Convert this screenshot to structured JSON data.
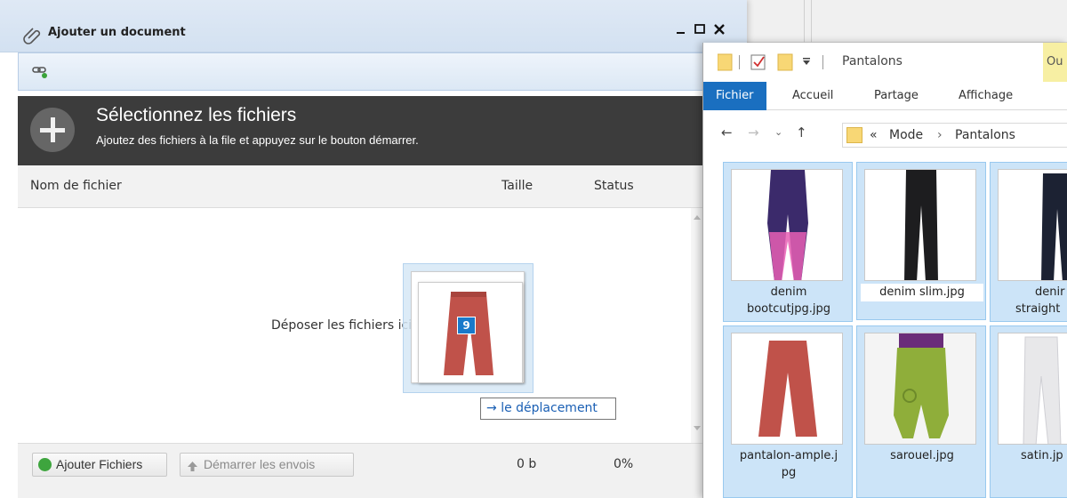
{
  "dialog": {
    "title": "Ajouter un document",
    "header_title": "Sélectionnez les fichiers",
    "header_subtitle": "Ajoutez des fichiers à la file et appuyez sur le bouton démarrer.",
    "columns": {
      "name": "Nom de fichier",
      "size": "Taille",
      "status": "Status"
    },
    "drop_text": "Déposer les fichiers ici.",
    "drag_count": "9",
    "drag_tooltip": "le déplacement",
    "buttons": {
      "add": "Ajouter Fichiers",
      "start": "Démarrer les envois"
    },
    "footer": {
      "size": "0 b",
      "percent": "0%"
    },
    "window_controls": [
      "minimize-icon",
      "maximize-icon",
      "close-icon"
    ]
  },
  "explorer": {
    "title": "Pantalons",
    "partial_tab": "Ou",
    "tabs": [
      "Fichier",
      "Accueil",
      "Partage",
      "Affichage"
    ],
    "breadcrumb": {
      "overflow": "«",
      "parts": [
        "Mode",
        "Pantalons"
      ]
    },
    "files": [
      {
        "name": "denim bootcutjpg.jpg",
        "line1": "denim",
        "line2": "bootcutjpg.jpg",
        "selected": true
      },
      {
        "name": "denim slim.jpg",
        "line1": "denim slim.jpg",
        "line2": "",
        "selected": true
      },
      {
        "name": "denim straight",
        "line1": "denir",
        "line2": "straight",
        "selected": true
      },
      {
        "name": "pantalon-ample.jpg",
        "line1": "pantalon-ample.j",
        "line2": "pg",
        "selected": true
      },
      {
        "name": "sarouel.jpg",
        "line1": "sarouel.jpg",
        "line2": "",
        "selected": true
      },
      {
        "name": "satin.jpg",
        "line1": "satin.jp",
        "line2": "",
        "selected": true
      }
    ]
  },
  "colors": {
    "accent": "#1a6fc0",
    "selection": "#cce4f8",
    "header_dark": "#3c3c3c",
    "tooltip_text": "#1a5fb4"
  }
}
